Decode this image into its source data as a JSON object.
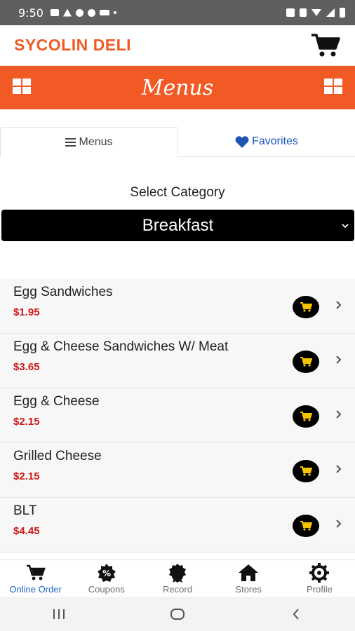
{
  "status_bar": {
    "time": "9:50"
  },
  "header": {
    "brand": "SYCOLIN DELI",
    "cart_icon": "cart-icon"
  },
  "menu_bar": {
    "title": "Menus",
    "left_icon": "grid-icon",
    "right_icon": "grid-icon"
  },
  "tabs": [
    {
      "label": "Menus",
      "icon": "menu-icon",
      "active": true
    },
    {
      "label": "Favorites",
      "icon": "heart-icon",
      "active": false
    }
  ],
  "category": {
    "label": "Select Category",
    "selected": "Breakfast"
  },
  "items": [
    {
      "name": "Egg Sandwiches",
      "price": "$1.95"
    },
    {
      "name": "Egg & Cheese Sandwiches W/ Meat",
      "price": "$3.65"
    },
    {
      "name": "Egg & Cheese",
      "price": "$2.15"
    },
    {
      "name": "Grilled Cheese",
      "price": "$2.15"
    },
    {
      "name": "BLT",
      "price": "$4.45"
    }
  ],
  "bottom_nav": [
    {
      "label": "Online Order",
      "icon": "cart-icon",
      "active": true
    },
    {
      "label": "Coupons",
      "icon": "coupon-icon",
      "active": false
    },
    {
      "label": "Record",
      "icon": "award-icon",
      "active": false
    },
    {
      "label": "Stores",
      "icon": "home-icon",
      "active": false
    },
    {
      "label": "Profile",
      "icon": "gear-icon",
      "active": false
    }
  ],
  "colors": {
    "brand": "#f15a24",
    "price": "#cc1a1a",
    "active_nav": "#1f63c6",
    "cart_badge": "#f5c400"
  }
}
